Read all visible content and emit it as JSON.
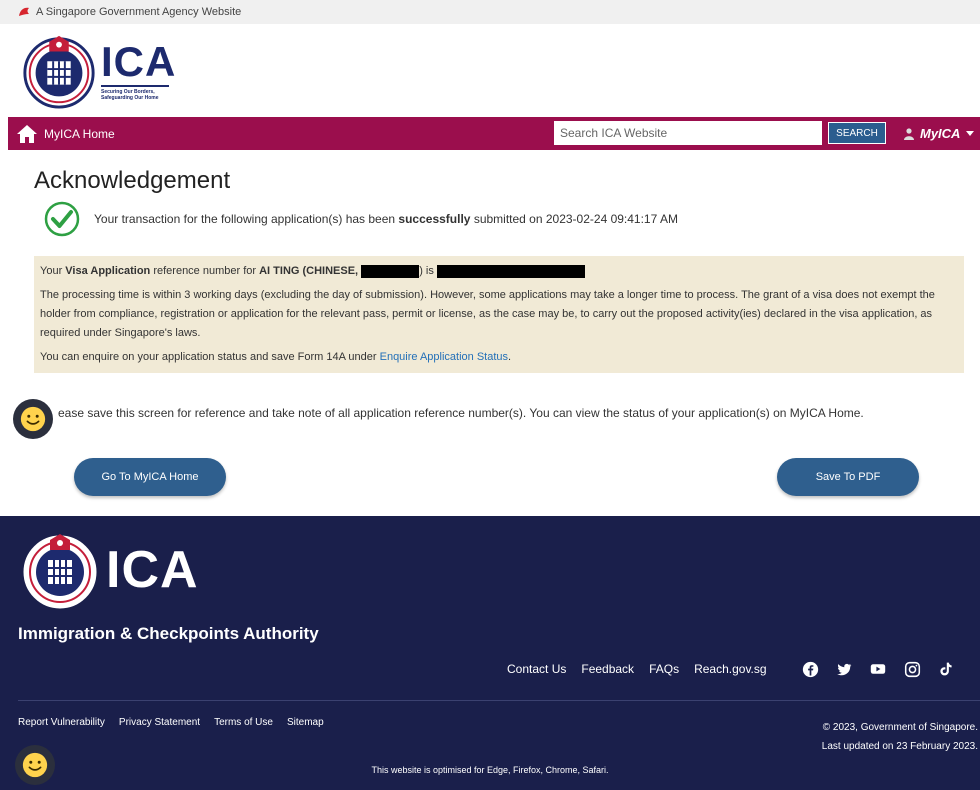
{
  "gov_bar": {
    "text": "A Singapore Government Agency Website",
    "icon": "lion-head-icon"
  },
  "header": {
    "logo_text": "ICA",
    "tagline_1": "Securing Our Borders,",
    "tagline_2": "Safeguarding Our Home"
  },
  "nav": {
    "home_label": "MyICA Home",
    "search_placeholder": "Search ICA Website",
    "search_button": "SEARCH",
    "account_label": "MyICA"
  },
  "main": {
    "title": "Acknowledgement",
    "success_prefix": "Your transaction for the following application(s) has been",
    "success_bold": "successfully",
    "success_suffix": "submitted on 2023-02-24 09:41:17 AM",
    "visa": {
      "prefix": "Your",
      "app_type": "Visa Application",
      "mid": "reference number for",
      "name": "AI TING (CHINESE,",
      "close": ") is"
    },
    "processing_text": "The processing time is within 3 working days (excluding the day of submission). However, some applications may take a longer time to process. The grant of a visa does not exempt the holder from compliance, registration or application for the relevant pass, permit or license, as the case may be, to carry out the proposed activity(ies) declared in the visa application, as required under Singapore's laws.",
    "enquire_prefix": "You can enquire on your application status and save Form 14A under",
    "enquire_link": "Enquire Application Status",
    "enquire_suffix": ".",
    "save_note": "ease save this screen for reference and take note of all application reference number(s). You can view the status of your application(s) on MyICA Home.",
    "btn_home": "Go To MyICA Home",
    "btn_pdf": "Save To PDF"
  },
  "footer": {
    "logo_text": "ICA",
    "org_name": "Immigration & Checkpoints Authority",
    "links": [
      "Contact Us",
      "Feedback",
      "FAQs",
      "Reach.gov.sg"
    ],
    "social_icons": [
      "facebook-icon",
      "twitter-icon",
      "youtube-icon",
      "instagram-icon",
      "tiktok-icon"
    ],
    "bottom_links": [
      "Report Vulnerability",
      "Privacy Statement",
      "Terms of Use",
      "Sitemap"
    ],
    "copyright": "© 2023, Government of Singapore.",
    "last_updated": "Last updated on 23 February 2023.",
    "optimised": "This website is optimised for Edge, Firefox, Chrome, Safari."
  },
  "colors": {
    "nav_bg": "#9b0e4d",
    "footer_bg": "#1a1f4b",
    "button_bg": "#2f5f8e",
    "info_bg": "#f1ead6",
    "success_green": "#2ea043",
    "link": "#2470b8"
  }
}
